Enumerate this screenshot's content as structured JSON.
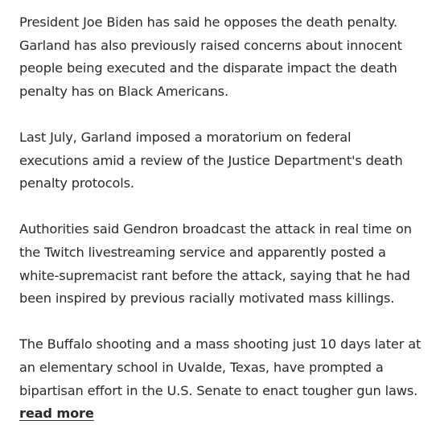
{
  "article": {
    "paragraphs": [
      "President Joe Biden has said he opposes the death penalty. Garland has also previously raised concerns about innocent people being executed and the disparate impact the death penalty has on Black Americans.",
      "Last July, Garland imposed a moratorium on federal executions amid a review of the Justice Department's death penalty protocols.",
      "Authorities said Gendron broadcast the attack in real time on the Twitch livestreaming service and apparently posted a white-supremacist rant before the attack, saying that he had been inspired by previous racially motivated mass killings.",
      "The Buffalo shooting and a mass shooting just 10 days later at an elementary school in Uvalde, Texas, have prompted a bipartisan effort in the U.S. Senate to enact tougher gun laws."
    ],
    "read_more_label": "read more"
  }
}
